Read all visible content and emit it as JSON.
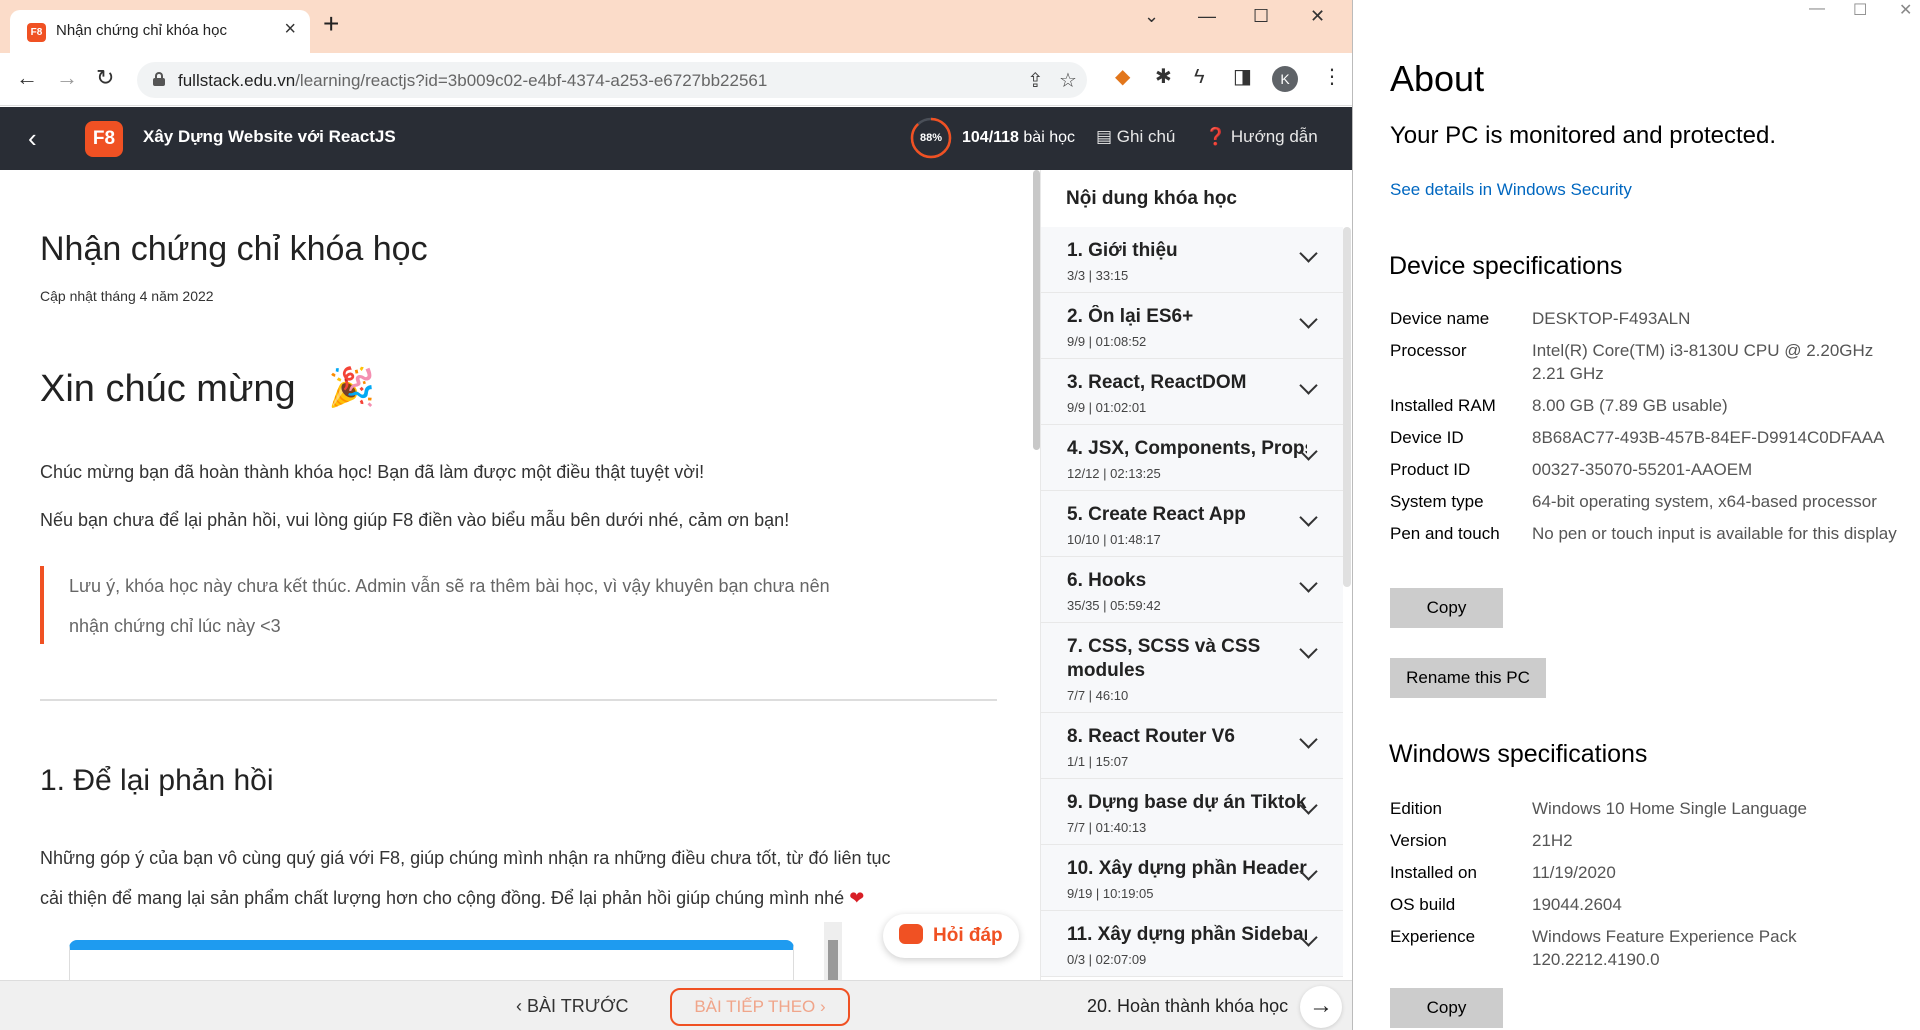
{
  "browser": {
    "tab_title": "Nhận chứng chỉ khóa học",
    "favicon_text": "F8",
    "new_tab_glyph": "+",
    "url_host": "fullstack.edu.vn",
    "url_path": "/learning/reactjs?id=3b009c02-e4bf-4374-a253-e6727bb22561",
    "profile_initial": "K"
  },
  "header": {
    "logo": "F8",
    "course_title": "Xây Dựng Website với ReactJS",
    "progress_percent": "88%",
    "progress_value": 0.88,
    "lesson_done": "104/118",
    "lesson_suffix": " bài học",
    "notes": "Ghi chú",
    "guide": "Hướng dẫn"
  },
  "content": {
    "title": "Nhận chứng chỉ khóa học",
    "updated": "Cập nhật tháng 4 năm 2022",
    "congrats": "Xin chúc mừng",
    "p1": "Chúc mừng bạn đã hoàn thành khóa học! Bạn đã làm được một điều thật tuyệt vời!",
    "p2": "Nếu bạn chưa để lại phản hồi, vui lòng giúp F8 điền vào biểu mẫu bên dưới nhé, cảm ơn bạn!",
    "note_line1": "Lưu ý, khóa học này chưa kết thúc. Admin vẫn sẽ ra thêm bài học, vì vậy khuyên bạn chưa nên",
    "note_line2": "nhận chứng chỉ lúc này <3",
    "section1": "1. Để lại phản hồi",
    "p3_line1": "Những góp ý của bạn vô cùng quý giá với F8, giúp chúng mình nhận ra những điều chưa tốt, từ đó liên tục",
    "p3_line2": "cải thiện để mang lại sản phẩm chất lượng hơn cho cộng đồng. Để lại phản hồi giúp chúng mình nhé",
    "qa_button": "Hỏi đáp"
  },
  "sidebar": {
    "heading": "Nội dung khóa học",
    "sections": [
      {
        "title": "1. Giới thiệu",
        "meta": "3/3 | 33:15"
      },
      {
        "title": "2. Ôn lại ES6+",
        "meta": "9/9 | 01:08:52"
      },
      {
        "title": "3. React, ReactDOM",
        "meta": "9/9 | 01:02:01"
      },
      {
        "title": "4. JSX, Components, Props",
        "meta": "12/12 | 02:13:25"
      },
      {
        "title": "5. Create React App",
        "meta": "10/10 | 01:48:17"
      },
      {
        "title": "6. Hooks",
        "meta": "35/35 | 05:59:42"
      },
      {
        "title": "7. CSS, SCSS và CSS modules",
        "meta": "7/7 | 46:10"
      },
      {
        "title": "8. React Router V6",
        "meta": "1/1 | 15:07"
      },
      {
        "title": "9. Dựng base dự án Tiktok",
        "meta": "7/7 | 01:40:13"
      },
      {
        "title": "10. Xây dựng phần Header",
        "meta": "9/19 | 10:19:05"
      },
      {
        "title": "11. Xây dựng phần Sidebar",
        "meta": "0/3 | 02:07:09"
      }
    ]
  },
  "bottom": {
    "prev": "BÀI TRƯỚC",
    "next": "BÀI TIẾP THEO",
    "finish_label": "20. Hoàn thành khóa học"
  },
  "settings": {
    "title": "About",
    "subtitle": "Your PC is monitored and protected.",
    "security_link": "See details in Windows Security",
    "device_heading": "Device specifications",
    "device_specs": [
      {
        "k": "Device name",
        "v": "DESKTOP-F493ALN"
      },
      {
        "k": "Processor",
        "v": "Intel(R) Core(TM) i3-8130U CPU @ 2.20GHz 2.21 GHz"
      },
      {
        "k": "Installed RAM",
        "v": "8.00 GB (7.89 GB usable)"
      },
      {
        "k": "Device ID",
        "v": "8B68AC77-493B-457B-84EF-D9914C0DFAAA"
      },
      {
        "k": "Product ID",
        "v": "00327-35070-55201-AAOEM"
      },
      {
        "k": "System type",
        "v": "64-bit operating system, x64-based processor"
      },
      {
        "k": "Pen and touch",
        "v": "No pen or touch input is available for this display"
      }
    ],
    "copy": "Copy",
    "rename": "Rename this PC",
    "windows_heading": "Windows specifications",
    "windows_specs": [
      {
        "k": "Edition",
        "v": "Windows 10 Home Single Language"
      },
      {
        "k": "Version",
        "v": "21H2"
      },
      {
        "k": "Installed on",
        "v": "11/19/2020"
      },
      {
        "k": "OS build",
        "v": "19044.2604"
      },
      {
        "k": "Experience",
        "v": "Windows Feature Experience Pack 120.2212.4190.0"
      }
    ],
    "copy2": "Copy"
  },
  "colors": {
    "brand": "#f05123",
    "header_bg": "#292d35",
    "link": "#0067c0",
    "tabbar": "#fbdcc9"
  }
}
